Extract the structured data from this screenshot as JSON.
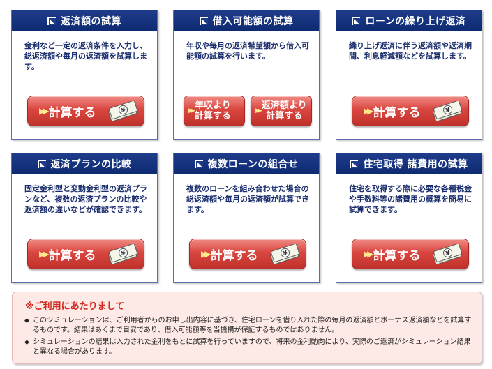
{
  "cards": [
    {
      "title": "返済額の試算",
      "description": "金利など一定の返済条件を入力し、総返済額や毎月の返済額を試算します。",
      "button": "計算する"
    },
    {
      "title": "借入可能額の試算",
      "description": "年収や毎月の返済希望額から借入可能額の試算を行います。",
      "buttons": [
        "年収より\n計算する",
        "返済額より\n計算する"
      ]
    },
    {
      "title": "ローンの繰り上げ返済",
      "description": "繰り上げ返済に伴う返済額や返済期間、利息軽減額などを試算します。",
      "button": "計算する"
    },
    {
      "title": "返済プランの比較",
      "description": "固定金利型と変動金利型の返済プランなど、複数の返済プランの比較や返済額の違いなどが確認できます。",
      "button": "計算する"
    },
    {
      "title": "複数ローンの組合せ",
      "description": "複数のローンを組み合わせた場合の総返済額や毎月の返済額が試算できます。",
      "button": "計算する"
    },
    {
      "title": "住宅取得 諸費用の試算",
      "description": "住宅を取得する際に必要な各種税金や手数料等の諸費用の概算を簡易に試算できます。",
      "button": "計算する"
    }
  ],
  "money_icon_text": "¥",
  "notice": {
    "title": "※ご利用にあたりまして",
    "items": [
      "このシミュレーションは、ご利用者からのお申し出内容に基づき、住宅ローンを借り入れた際の毎月の返済額とボーナス返済額などを試算するものです。結果はあくまで目安であり、借入可能額等を当機構が保証するものではありません。",
      "シミュレーションの結果は入力された金利をもとに試算を行っていますので、将来の金利動向により、実際のご返済がシミュレーション結果と異なる場合があります。"
    ]
  },
  "colors": {
    "header_blue": "#1f3c8a",
    "button_red": "#d9463f",
    "notice_bg": "#fde9e6",
    "notice_title": "#d02a20"
  }
}
